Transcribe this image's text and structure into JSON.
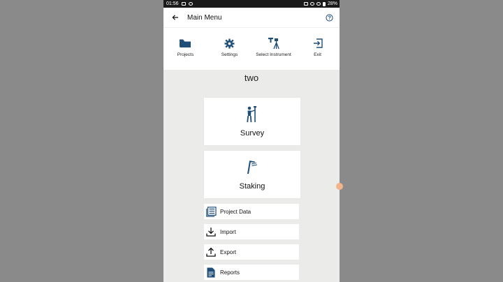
{
  "status": {
    "time": "01:56",
    "battery": "28%"
  },
  "header": {
    "title": "Main Menu"
  },
  "toolbar": {
    "items": [
      {
        "label": "Projects",
        "icon": "folder-icon"
      },
      {
        "label": "Settings",
        "icon": "gear-icon"
      },
      {
        "label": "Select Instrument",
        "icon": "tripod-instrument-icon"
      },
      {
        "label": "Exit",
        "icon": "exit-icon"
      }
    ]
  },
  "project": {
    "name": "two"
  },
  "main": {
    "survey_label": "Survey",
    "staking_label": "Staking",
    "project_data_label": "Project Data",
    "import_label": "Import",
    "export_label": "Export",
    "reports_label": "Reports"
  },
  "colors": {
    "accent": "#1f4e79",
    "background": "#ebece9",
    "card": "#ffffff"
  }
}
